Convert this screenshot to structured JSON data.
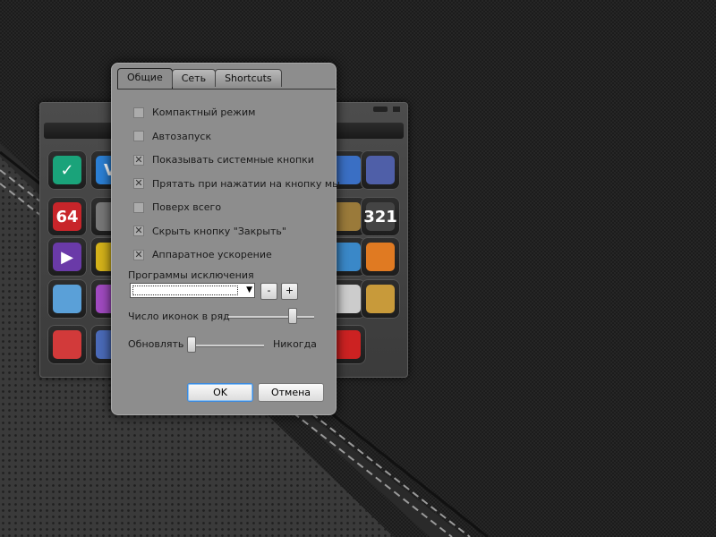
{
  "dialog": {
    "tabs": [
      {
        "label": "Общие",
        "active": true
      },
      {
        "label": "Сеть",
        "active": false
      },
      {
        "label": "Shortcuts",
        "active": false
      }
    ],
    "options": [
      {
        "label": "Компактный режим",
        "checked": false
      },
      {
        "label": "Автозапуск",
        "checked": false
      },
      {
        "label": "Показывать системные кнопки",
        "checked": true
      },
      {
        "label": "Прятать при нажатии на кнопку мы",
        "checked": true
      },
      {
        "label": "Поверх всего",
        "checked": false
      },
      {
        "label": "Скрыть кнопку \"Закрыть\"",
        "checked": true
      },
      {
        "label": "Аппаратное ускорение",
        "checked": true
      }
    ],
    "exclusions_label": "Программы исключения",
    "exclusions_value": "",
    "remove_label": "-",
    "add_label": "+",
    "icons_per_row_label": "Число иконок в ряд",
    "icons_per_row_level": 0.75,
    "refresh_label": "Обновлять",
    "refresh_value_label": "Никогда",
    "refresh_level": 0.0,
    "ok_label": "OK",
    "cancel_label": "Отмена",
    "check_mark": "✕"
  },
  "launcher": {
    "tiles": [
      {
        "icon": "shield-icon",
        "color": "#1aa37a",
        "text": "✓"
      },
      {
        "icon": "vm-icon",
        "color": "#2b7fd4",
        "text": "V"
      },
      {
        "icon": "monitor-icon",
        "color": "#3a6fc4",
        "text": ""
      },
      {
        "icon": "ufo-icon",
        "color": "#4f5fa8",
        "text": ""
      },
      {
        "icon": "aida64-icon",
        "color": "#c8252a",
        "text": "64"
      },
      {
        "icon": "disk-icon",
        "color": "#777777",
        "text": ""
      },
      {
        "icon": "package-icon",
        "color": "#9a7a3a",
        "text": ""
      },
      {
        "icon": "mpc-icon",
        "color": "#444444",
        "text": "321"
      },
      {
        "icon": "media-player-icon",
        "color": "#6a3aa8",
        "text": "▶"
      },
      {
        "icon": "warning-icon",
        "color": "#d4b21a",
        "text": ""
      },
      {
        "icon": "cursor-icon",
        "color": "#3a88c8",
        "text": ""
      },
      {
        "icon": "firefox-icon",
        "color": "#e07a22",
        "text": ""
      },
      {
        "icon": "windows-icon",
        "color": "#5aa0d8",
        "text": ""
      },
      {
        "icon": "rainbow-icon",
        "color": "#a04ac0",
        "text": ""
      },
      {
        "icon": "document-icon",
        "color": "#cccccc",
        "text": ""
      },
      {
        "icon": "paint-icon",
        "color": "#c89a3a",
        "text": ""
      },
      {
        "icon": "cube-icon",
        "color": "#d23a3a",
        "text": ""
      },
      {
        "icon": "chip-icon",
        "color": "#4a6ab8",
        "text": ""
      },
      {
        "icon": "opera-icon",
        "color": "#cc2222",
        "text": ""
      }
    ]
  }
}
